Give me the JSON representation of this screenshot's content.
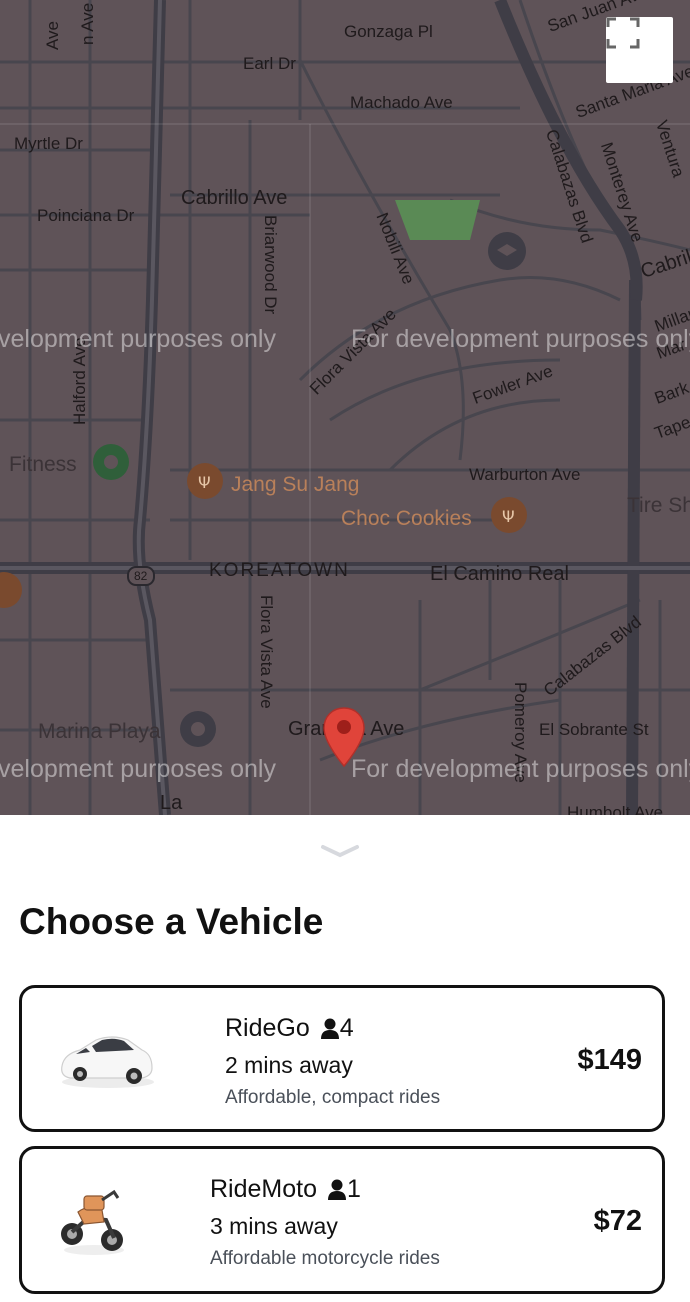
{
  "map": {
    "roads": [
      {
        "label": "Gonzaga Pl"
      },
      {
        "label": "Earl Dr"
      },
      {
        "label": "Machado Ave"
      },
      {
        "label": "San Juan Ave"
      },
      {
        "label": "Santa Maria Ave"
      },
      {
        "label": "Myrtle Dr"
      },
      {
        "label": "Cabrillo Ave"
      },
      {
        "label": "Poinciana Dr"
      },
      {
        "label": "Briarwood Dr"
      },
      {
        "label": "Nobili Ave"
      },
      {
        "label": "Calabazas Blvd"
      },
      {
        "label": "Monterey Ave"
      },
      {
        "label": "Flora Vista Ave"
      },
      {
        "label": "Fowler Ave"
      },
      {
        "label": "Halford Ave"
      },
      {
        "label": "Warburton Ave"
      },
      {
        "label": "KOREATOWN"
      },
      {
        "label": "El Camino Real"
      },
      {
        "label": "Flora Vista Ave"
      },
      {
        "label": "Calabazas Blvd"
      },
      {
        "label": "Granada Ave"
      },
      {
        "label": "Pomeroy Ave"
      },
      {
        "label": "El Sobrante St"
      },
      {
        "label": "Humbolt Ave"
      },
      {
        "label": "Cabrillo"
      },
      {
        "label": "Millar"
      },
      {
        "label": "Mar"
      },
      {
        "label": "Bark"
      },
      {
        "label": "Tape"
      },
      {
        "label": "Ventura"
      },
      {
        "label": "La"
      },
      {
        "label": "Ave"
      },
      {
        "label": "n Ave"
      },
      {
        "label": "82"
      }
    ],
    "pois": [
      {
        "label": "Fitness"
      },
      {
        "label": "Jang Su Jang"
      },
      {
        "label": "Choc Cookies"
      },
      {
        "label": "Marina Playa"
      },
      {
        "label": "Tire Sh"
      }
    ],
    "watermark": "For development purposes only",
    "watermark_left": "velopment purposes only",
    "colors": {
      "overlay": "#5f5358",
      "road": "#48464e",
      "park": "#5a8a55",
      "pin": "#e0443a"
    }
  },
  "fullscreen": {
    "icon": "fullscreen-icon"
  },
  "sheet": {
    "handle_icon": "chevron-down-icon",
    "title": "Choose a Vehicle",
    "vehicles": [
      {
        "name": "RideGo",
        "seats": "4",
        "eta": "2 mins away",
        "description": "Affordable, compact rides",
        "price": "$149",
        "icon": "car-image"
      },
      {
        "name": "RideMoto",
        "seats": "1",
        "eta": "3 mins away",
        "description": "Affordable motorcycle rides",
        "price": "$72",
        "icon": "motorcycle-image"
      }
    ]
  }
}
